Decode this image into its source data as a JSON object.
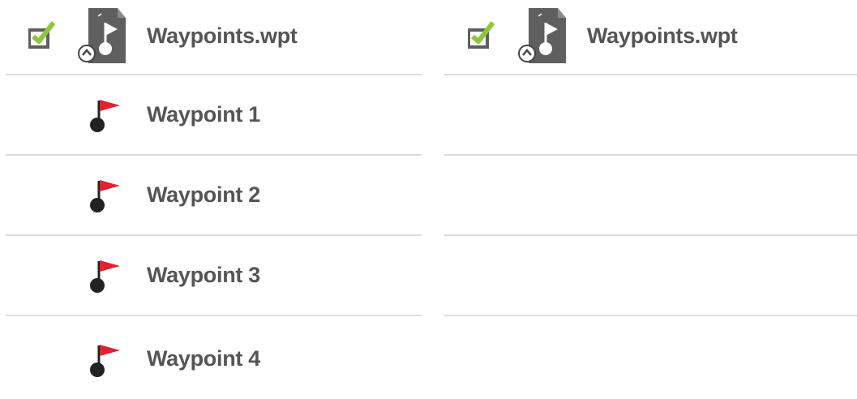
{
  "left_panel": {
    "file": {
      "name": "Waypoints.wpt",
      "checked": true,
      "icon": "waypoint-file-icon"
    },
    "items": [
      {
        "label": "Waypoint 1",
        "icon": "red-flag-icon"
      },
      {
        "label": "Waypoint 2",
        "icon": "red-flag-icon"
      },
      {
        "label": "Waypoint 3",
        "icon": "red-flag-icon"
      },
      {
        "label": "Waypoint 4",
        "icon": "red-flag-icon"
      }
    ]
  },
  "right_panel": {
    "file": {
      "name": "Waypoints.wpt",
      "checked": true,
      "icon": "waypoint-file-icon"
    },
    "empty_rows": 3
  },
  "colors": {
    "text": "#555555",
    "divider": "#dcdcdc",
    "check_green": "#8dc63f",
    "flag_red": "#e0212e",
    "file_gray": "#5f5f5f"
  }
}
